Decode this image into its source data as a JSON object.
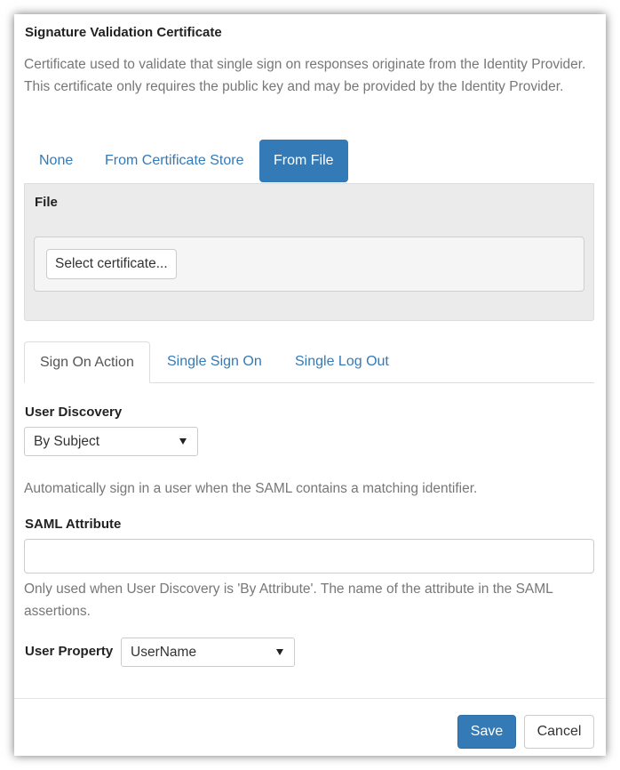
{
  "certificate": {
    "title": "Signature Validation Certificate",
    "description": "Certificate used to validate that single sign on responses originate from the Identity Provider. This certificate only requires the public key and may be provided by the Identity Provider.",
    "source_tabs": [
      {
        "label": "None",
        "active": false
      },
      {
        "label": "From Certificate Store",
        "active": false
      },
      {
        "label": "From File",
        "active": true
      }
    ],
    "file": {
      "label": "File",
      "select_button": "Select certificate..."
    }
  },
  "tabs": [
    {
      "label": "Sign On Action",
      "active": true
    },
    {
      "label": "Single Sign On",
      "active": false
    },
    {
      "label": "Single Log Out",
      "active": false
    }
  ],
  "sign_on_action": {
    "user_discovery": {
      "label": "User Discovery",
      "value": "By Subject",
      "help": "Automatically sign in a user when the SAML contains a matching identifier."
    },
    "saml_attribute": {
      "label": "SAML Attribute",
      "value": "",
      "help": "Only used when User Discovery is 'By Attribute'. The name of the attribute in the SAML assertions."
    },
    "user_property": {
      "label": "User Property",
      "value": "UserName"
    }
  },
  "footer": {
    "save_label": "Save",
    "cancel_label": "Cancel"
  },
  "colors": {
    "primary": "#337ab7",
    "muted_text": "#777777",
    "panel_bg": "#ebebeb"
  }
}
